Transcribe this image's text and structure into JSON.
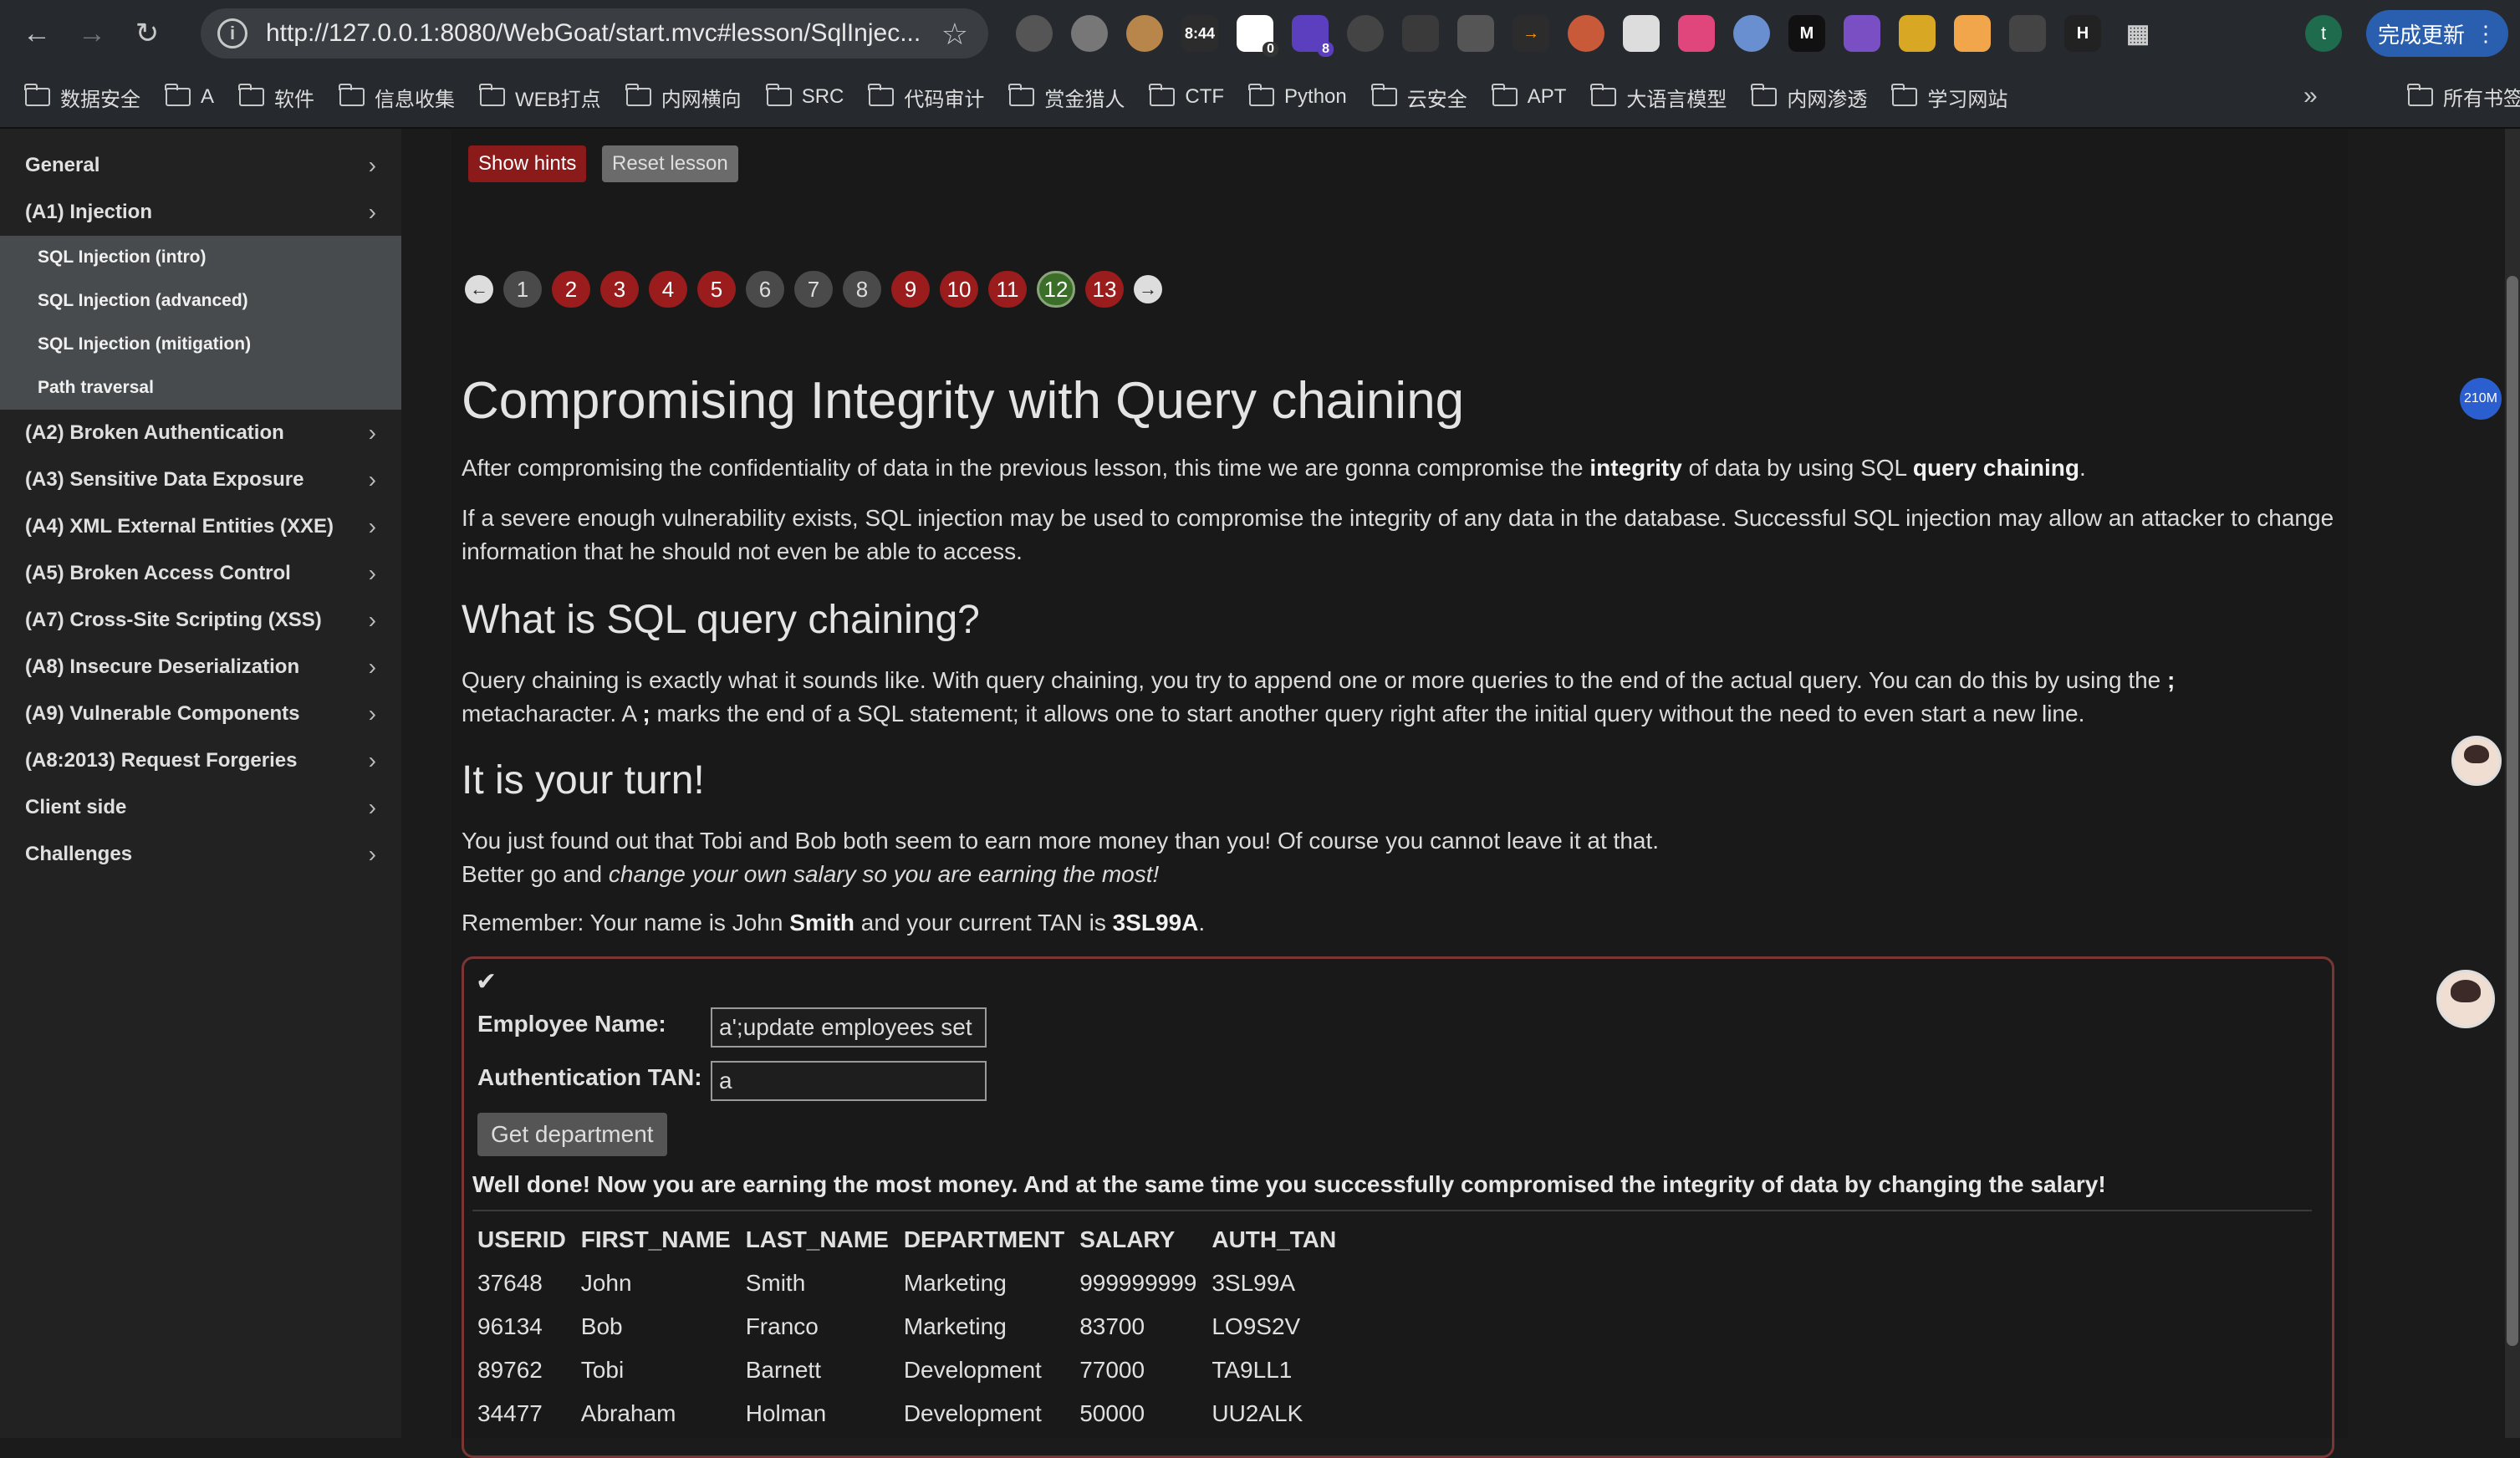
{
  "browser": {
    "url": "http://127.0.0.1:8080/WebGoat/start.mvc#lesson/SqlInjec...",
    "time_badge": "8:44",
    "ext_badge_count_a": "0",
    "ext_badge_count_b": "8",
    "profile_initial": "t",
    "update_button": "完成更新",
    "bookmarks": [
      "数据安全",
      "A",
      "软件",
      "信息收集",
      "WEB打点",
      "内网横向",
      "SRC",
      "代码审计",
      "赏金猎人",
      "CTF",
      "Python",
      "云安全",
      "APT",
      "大语言模型",
      "内网渗透",
      "学习网站"
    ],
    "all_bookmarks": "所有书签",
    "more": "»"
  },
  "sidebar": {
    "items": [
      {
        "label": "General"
      },
      {
        "label": "(A1) Injection"
      },
      {
        "label": "(A2) Broken Authentication"
      },
      {
        "label": "(A3) Sensitive Data Exposure"
      },
      {
        "label": "(A4) XML External Entities (XXE)"
      },
      {
        "label": "(A5) Broken Access Control"
      },
      {
        "label": "(A7) Cross-Site Scripting (XSS)"
      },
      {
        "label": "(A8) Insecure Deserialization"
      },
      {
        "label": "(A9) Vulnerable Components"
      },
      {
        "label": "(A8:2013) Request Forgeries"
      },
      {
        "label": "Client side"
      },
      {
        "label": "Challenges"
      }
    ],
    "subitems": [
      {
        "label": "SQL Injection (intro)"
      },
      {
        "label": "SQL Injection (advanced)"
      },
      {
        "label": "SQL Injection (mitigation)"
      },
      {
        "label": "Path traversal"
      }
    ]
  },
  "lesson": {
    "show_hints": "Show hints",
    "reset_lesson": "Reset lesson",
    "pages": [
      {
        "n": "1",
        "state": "gray"
      },
      {
        "n": "2",
        "state": "red"
      },
      {
        "n": "3",
        "state": "red"
      },
      {
        "n": "4",
        "state": "red"
      },
      {
        "n": "5",
        "state": "red"
      },
      {
        "n": "6",
        "state": "gray"
      },
      {
        "n": "7",
        "state": "gray"
      },
      {
        "n": "8",
        "state": "gray"
      },
      {
        "n": "9",
        "state": "red"
      },
      {
        "n": "10",
        "state": "red"
      },
      {
        "n": "11",
        "state": "red"
      },
      {
        "n": "12",
        "state": "green"
      },
      {
        "n": "13",
        "state": "red"
      }
    ],
    "title": "Compromising Integrity with Query chaining",
    "intro_a": "After compromising the confidentiality of data in the previous lesson, this time we are gonna compromise the ",
    "intro_b": "integrity",
    "intro_c": " of data by using SQL ",
    "intro_d": "query chaining",
    "intro_e": ".",
    "para2": "If a severe enough vulnerability exists, SQL injection may be used to compromise the integrity of any data in the database. Successful SQL injection may allow an attacker to change information that he should not even be able to access.",
    "h2_chaining": "What is SQL query chaining?",
    "chain_a": "Query chaining is exactly what it sounds like. With query chaining, you try to append one or more queries to the end of the actual query. You can do this by using the ",
    "chain_b": ";",
    "chain_c": " metacharacter. A ",
    "chain_d": ";",
    "chain_e": " marks the end of a SQL statement; it allows one to start another query right after the initial query without the need to even start a new line.",
    "h2_turn": "It is your turn!",
    "turn_line1": "You just found out that Tobi and Bob both seem to earn more money than you! Of course you cannot leave it at that.",
    "turn_line2a": "Better go and ",
    "turn_line2b": "change your own salary so you are earning the most!",
    "remember_a": "Remember: Your name is John ",
    "remember_b": "Smith",
    "remember_c": " and your current TAN is ",
    "remember_d": "3SL99A",
    "remember_e": "."
  },
  "form": {
    "name_label": "Employee Name:",
    "name_value": "a';update employees set",
    "tan_label": "Authentication TAN:",
    "tan_value": "a",
    "submit": "Get department",
    "feedback": "Well done! Now you are earning the most money. And at the same time you successfully compromised the integrity of data by changing the salary!"
  },
  "results": {
    "headers": [
      "USERID",
      "FIRST_NAME",
      "LAST_NAME",
      "DEPARTMENT",
      "SALARY",
      "AUTH_TAN"
    ],
    "rows": [
      [
        "37648",
        "John",
        "Smith",
        "Marketing",
        "999999999",
        "3SL99A"
      ],
      [
        "96134",
        "Bob",
        "Franco",
        "Marketing",
        "83700",
        "LO9S2V"
      ],
      [
        "89762",
        "Tobi",
        "Barnett",
        "Development",
        "77000",
        "TA9LL1"
      ],
      [
        "34477",
        "Abraham",
        "Holman",
        "Development",
        "50000",
        "UU2ALK"
      ]
    ]
  },
  "overlay": {
    "memory_badge": "210M"
  }
}
